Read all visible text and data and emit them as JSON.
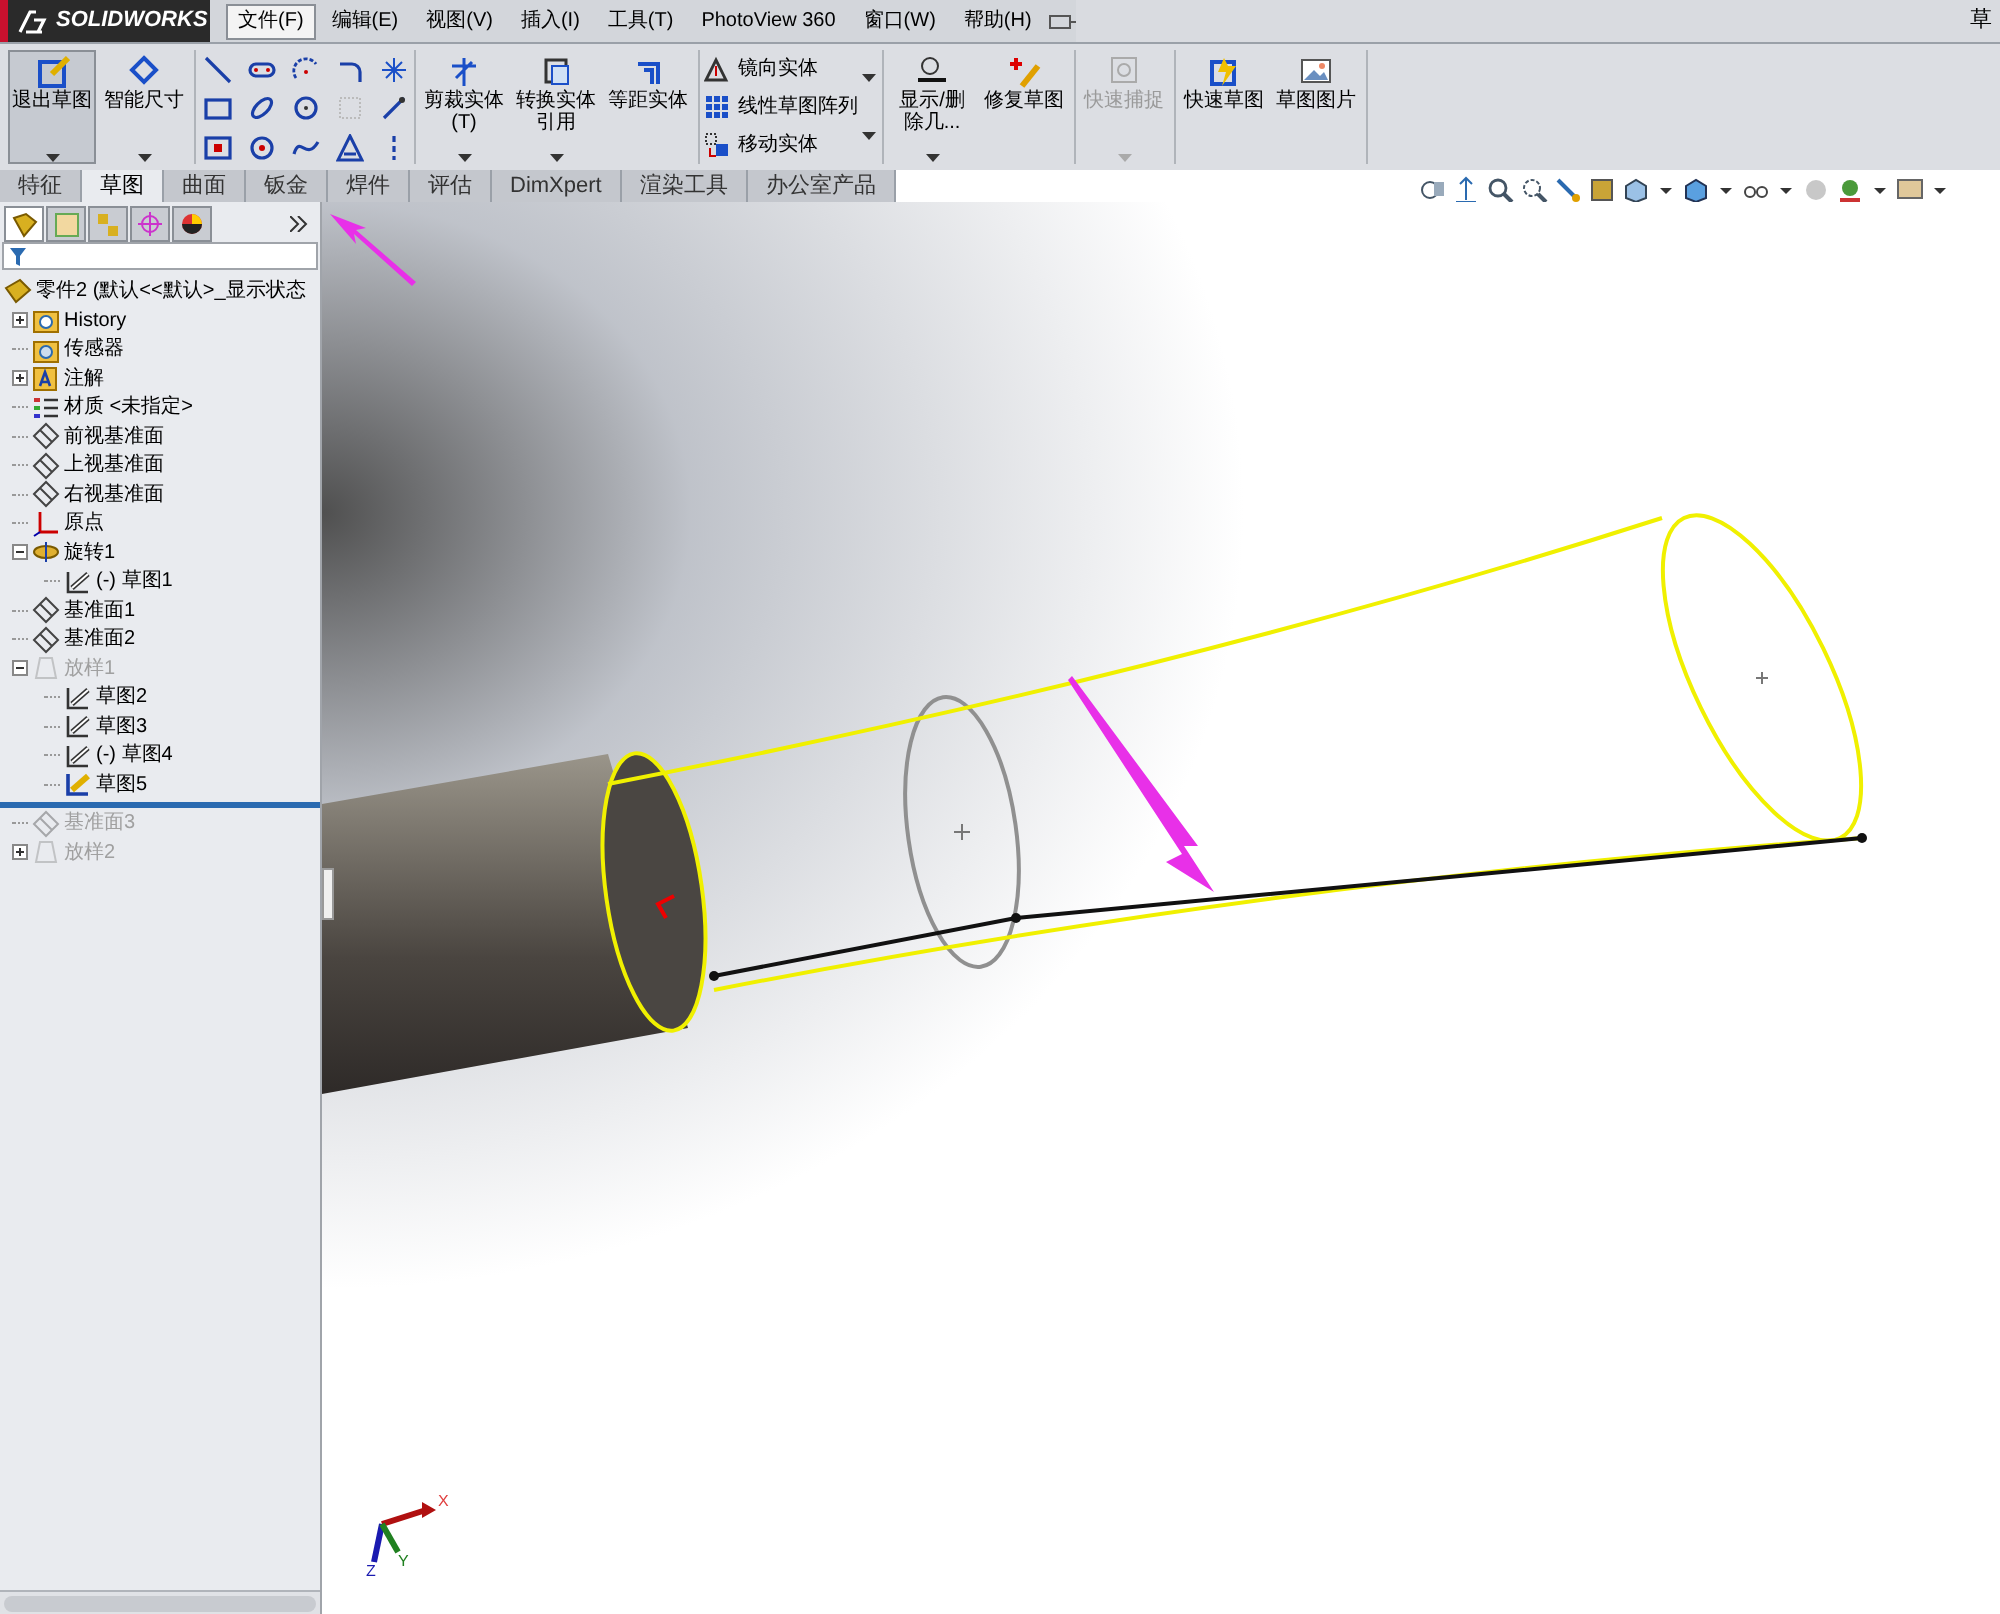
{
  "title_bar": {
    "logo": "SOLIDWORKS",
    "title": "草",
    "menu": [
      {
        "label": "文件(F)",
        "selected": true
      },
      {
        "label": "编辑(E)",
        "selected": false
      },
      {
        "label": "视图(V)",
        "selected": false
      },
      {
        "label": "插入(I)",
        "selected": false
      },
      {
        "label": "工具(T)",
        "selected": false
      },
      {
        "label": "PhotoView 360",
        "selected": false
      },
      {
        "label": "窗口(W)",
        "selected": false
      },
      {
        "label": "帮助(H)",
        "selected": false
      }
    ]
  },
  "toolbar": {
    "groups": [
      {
        "kind": "large",
        "buttons": [
          {
            "label": "退出草图",
            "selected": true,
            "disabled": false,
            "dropdown": true
          },
          {
            "label": "智能尺寸",
            "selected": false,
            "disabled": false,
            "dropdown": true
          }
        ]
      },
      {
        "kind": "tools"
      },
      {
        "kind": "large",
        "buttons": [
          {
            "label": "剪裁实体(T)",
            "selected": false,
            "disabled": false,
            "dropdown": true
          },
          {
            "label": "转换实体引用",
            "selected": false,
            "disabled": false,
            "dropdown": true
          },
          {
            "label": "等距实体",
            "selected": false,
            "disabled": false,
            "dropdown": false
          }
        ]
      },
      {
        "kind": "list",
        "buttons": [
          {
            "label": "镜向实体"
          },
          {
            "label": "线性草图阵列"
          },
          {
            "label": "移动实体"
          }
        ]
      },
      {
        "kind": "large",
        "buttons": [
          {
            "label": "显示/删除几...",
            "selected": false,
            "disabled": false,
            "dropdown": true
          },
          {
            "label": "修复草图",
            "selected": false,
            "disabled": false,
            "dropdown": false
          }
        ]
      },
      {
        "kind": "large",
        "buttons": [
          {
            "label": "快速捕捉",
            "selected": false,
            "disabled": true,
            "dropdown": true
          }
        ]
      },
      {
        "kind": "large",
        "buttons": [
          {
            "label": "快速草图",
            "selected": false,
            "disabled": false,
            "dropdown": false
          },
          {
            "label": "草图图片",
            "selected": false,
            "disabled": false,
            "dropdown": false
          }
        ]
      }
    ]
  },
  "tabs": [
    {
      "label": "特征",
      "selected": false
    },
    {
      "label": "草图",
      "selected": true
    },
    {
      "label": "曲面",
      "selected": false
    },
    {
      "label": "钣金",
      "selected": false
    },
    {
      "label": "焊件",
      "selected": false
    },
    {
      "label": "评估",
      "selected": false
    },
    {
      "label": "DimXpert",
      "selected": false
    },
    {
      "label": "渲染工具",
      "selected": false
    },
    {
      "label": "办公室产品",
      "selected": false
    }
  ],
  "panel_tabs": [
    {
      "selected": true
    },
    {
      "selected": false
    },
    {
      "selected": false
    },
    {
      "selected": false
    },
    {
      "selected": false
    }
  ],
  "feature_tree": {
    "root": "零件2 (默认<<默认>_显示状态",
    "items": [
      {
        "label": "History",
        "kind": "history",
        "disabled": false,
        "expanded": false
      },
      {
        "label": "传感器",
        "kind": "sensor",
        "disabled": false
      },
      {
        "label": "注解",
        "kind": "annotation",
        "disabled": false,
        "expanded": false
      },
      {
        "label": "材质 <未指定>",
        "kind": "material",
        "disabled": false
      },
      {
        "label": "前视基准面",
        "kind": "plane",
        "disabled": false
      },
      {
        "label": "上视基准面",
        "kind": "plane",
        "disabled": false
      },
      {
        "label": "右视基准面",
        "kind": "plane",
        "disabled": false
      },
      {
        "label": "原点",
        "kind": "origin",
        "disabled": false
      },
      {
        "label": "旋转1",
        "kind": "revolve",
        "disabled": false,
        "expanded": true,
        "children": [
          {
            "label": "(-) 草图1",
            "kind": "sketch",
            "disabled": false,
            "active": false
          }
        ]
      },
      {
        "label": "基准面1",
        "kind": "plane",
        "disabled": false
      },
      {
        "label": "基准面2",
        "kind": "plane",
        "disabled": false
      },
      {
        "label": "放样1",
        "kind": "loft",
        "disabled": true,
        "expanded": true,
        "children": [
          {
            "label": "草图2",
            "kind": "sketch",
            "disabled": false,
            "active": false
          },
          {
            "label": "草图3",
            "kind": "sketch",
            "disabled": false,
            "active": false
          },
          {
            "label": "(-) 草图4",
            "kind": "sketch",
            "disabled": false,
            "active": false
          },
          {
            "label": "草图5",
            "kind": "sketch",
            "disabled": false,
            "active": true
          }
        ]
      },
      {
        "kind": "rollback"
      },
      {
        "label": "基准面3",
        "kind": "plane",
        "disabled": true
      },
      {
        "label": "放样2",
        "kind": "loft",
        "disabled": true,
        "expanded": false
      }
    ]
  },
  "viewport": {
    "triad": [
      "X",
      "Y",
      "Z"
    ]
  }
}
